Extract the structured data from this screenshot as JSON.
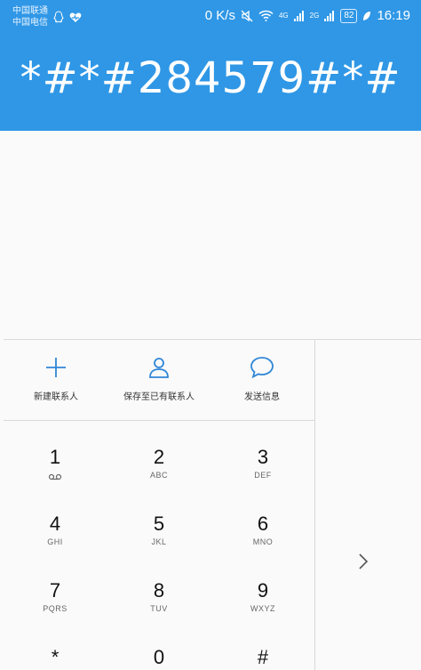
{
  "status_bar": {
    "carrier_1": "中国联通",
    "carrier_2": "中国电信",
    "net_speed": "0 K/s",
    "network_1": "4G",
    "network_2": "2G",
    "battery": "82",
    "time": "16:19"
  },
  "dialer": {
    "input_value": "*#*#284579#*#"
  },
  "actions": [
    {
      "icon": "plus-icon",
      "label": "新建联系人"
    },
    {
      "icon": "person-icon",
      "label": "保存至已有联系人"
    },
    {
      "icon": "message-icon",
      "label": "发送信息"
    }
  ],
  "keypad": [
    {
      "digit": "1",
      "letters": ""
    },
    {
      "digit": "2",
      "letters": "ABC"
    },
    {
      "digit": "3",
      "letters": "DEF"
    },
    {
      "digit": "4",
      "letters": "GHI"
    },
    {
      "digit": "5",
      "letters": "JKL"
    },
    {
      "digit": "6",
      "letters": "MNO"
    },
    {
      "digit": "7",
      "letters": "PQRS"
    },
    {
      "digit": "8",
      "letters": "TUV"
    },
    {
      "digit": "9",
      "letters": "WXYZ"
    },
    {
      "digit": "*",
      "letters": ""
    },
    {
      "digit": "0",
      "letters": ""
    },
    {
      "digit": "#",
      "letters": ""
    }
  ],
  "colors": {
    "accent": "#2f97e6",
    "icon_blue": "#2f86d7"
  }
}
